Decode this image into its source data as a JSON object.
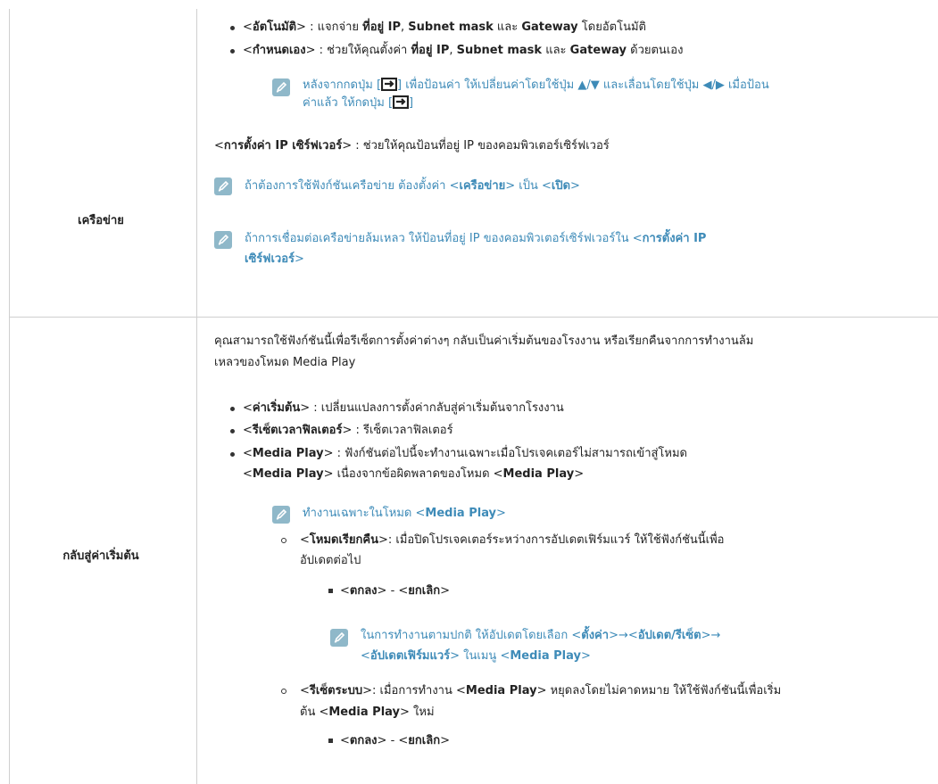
{
  "colors": {
    "note": "#3e8bb8",
    "border": "#cfcfcf",
    "icon": "#8fb8c9"
  },
  "network": {
    "label": "เครือข่าย",
    "b1_tag": "อัตโนมัติ",
    "b1_a": " : แจกจ่าย ",
    "b1_b": "ที่อยู่ IP",
    "b1_c": ", ",
    "b1_d": "Subnet mask",
    "b1_e": " และ ",
    "b1_f": "Gateway",
    "b1_g": " โดยอัตโนมัติ",
    "b2_tag": "กำหนดเอง",
    "b2_a": " : ช่วยให้คุณตั้งค่า ",
    "b2_b": "ที่อยู่ IP",
    "b2_c": ", ",
    "b2_d": "Subnet mask",
    "b2_e": " และ ",
    "b2_f": "Gateway",
    "b2_g": " ด้วยตนเอง",
    "note1_a": "หลังจากกดปุ่ม [",
    "note1_b": "] เพื่อป้อนค่า ให้เปลี่ยนค่าโดยใช้ปุ่ม ▲/▼ และเลื่อนโดยใช้ปุ่ม ◀/▶ เมื่อป้อน",
    "note1_c": "ค่าแล้ว ให้กดปุ่ม [",
    "note1_d": "]",
    "server_tag": "การตั้งค่า IP เซิร์ฟเวอร์",
    "server_desc": " : ช่วยให้คุณป้อนที่อยู่ IP ของคอมพิวเตอร์เซิร์ฟเวอร์",
    "note2_a": "ถ้าต้องการใช้ฟังก์ชันเครือข่าย ต้องตั้งค่า <",
    "note2_b": "เครือข่าย",
    "note2_c": "> เป็น <",
    "note2_d": "เปิด",
    "note2_e": ">",
    "note3_a": "ถ้าการเชื่อมต่อเครือข่ายล้มเหลว ให้ป้อนที่อยู่ IP ของคอมพิวเตอร์เซิร์ฟเวอร์ใน <",
    "note3_b": "การตั้งค่า IP",
    "note3_c": "เซิร์ฟเวอร์",
    "note3_d": ">"
  },
  "reset": {
    "label": "กลับสู่ค่าเริ่มต้น",
    "intro1": "คุณสามารถใช้ฟังก์ชันนี้เพื่อรีเซ็ตการตั้งค่าต่างๆ กลับเป็นค่าเริ่มต้นของโรงงาน หรือเรียกคืนจากการทำงานล้ม",
    "intro2": "เหลวของโหมด Media Play",
    "b1_tag": "ค่าเริ่มต้น",
    "b1_desc": " : เปลี่ยนแปลงการตั้งค่ากลับสู่ค่าเริ่มต้นจากโรงงาน",
    "b2_tag": "รีเซ็ตเวลาฟิลเตอร์",
    "b2_desc": " : รีเซ็ตเวลาฟิลเตอร์",
    "b3_tag": "Media Play",
    "b3_desc": " : ฟังก์ชันต่อไปนี้จะทำงานเฉพาะเมื่อโปรเจคเตอร์ไม่สามารถเข้าสู่โหมด",
    "b3_l2_tag": "Media Play",
    "b3_l2_mid": " เนื่องจากข้อผิดพลาดของโหมด <",
    "b3_l2_tag2": "Media Play",
    "b3_l2_end": ">",
    "note4_a": "ทำงานเฉพาะในโหมด <",
    "note4_b": "Media Play",
    "note4_c": ">",
    "sub1_tag": "โหมดเรียกคืน",
    "sub1_desc": ": เมื่อปิดโปรเจคเตอร์ระหว่างการอัปเดตเฟิร์มแวร์ ให้ใช้ฟังก์ชันนี้เพื่อ",
    "sub1_l2": "อัปเดตต่อไป",
    "ok": "ตกลง",
    "cancel": "ยกเลิก",
    "note5_a": "ในการทำงานตามปกติ ให้อัปเดตโดยเลือก <",
    "note5_b": "ตั้งค่า",
    "note5_c": ">→<",
    "note5_d": "อัปเดต/รีเซ็ต",
    "note5_e": ">→",
    "note5_f": "อัปเดตเฟิร์มแวร์",
    "note5_g": "> ในเมนู <",
    "note5_h": "Media Play",
    "note5_i": ">",
    "sub2_tag": "รีเซ็ตระบบ",
    "sub2_a": ": เมื่อการทำงาน <",
    "sub2_b": "Media Play",
    "sub2_c": "> หยุดลงโดยไม่คาดหมาย ให้ใช้ฟังก์ชันนี้เพื่อเริ่ม",
    "sub2_l2_a": "ต้น <",
    "sub2_l2_b": "Media Play",
    "sub2_l2_c": "> ใหม่",
    "ok2": "ตกลง",
    "cancel2": "ยกเลิก"
  }
}
